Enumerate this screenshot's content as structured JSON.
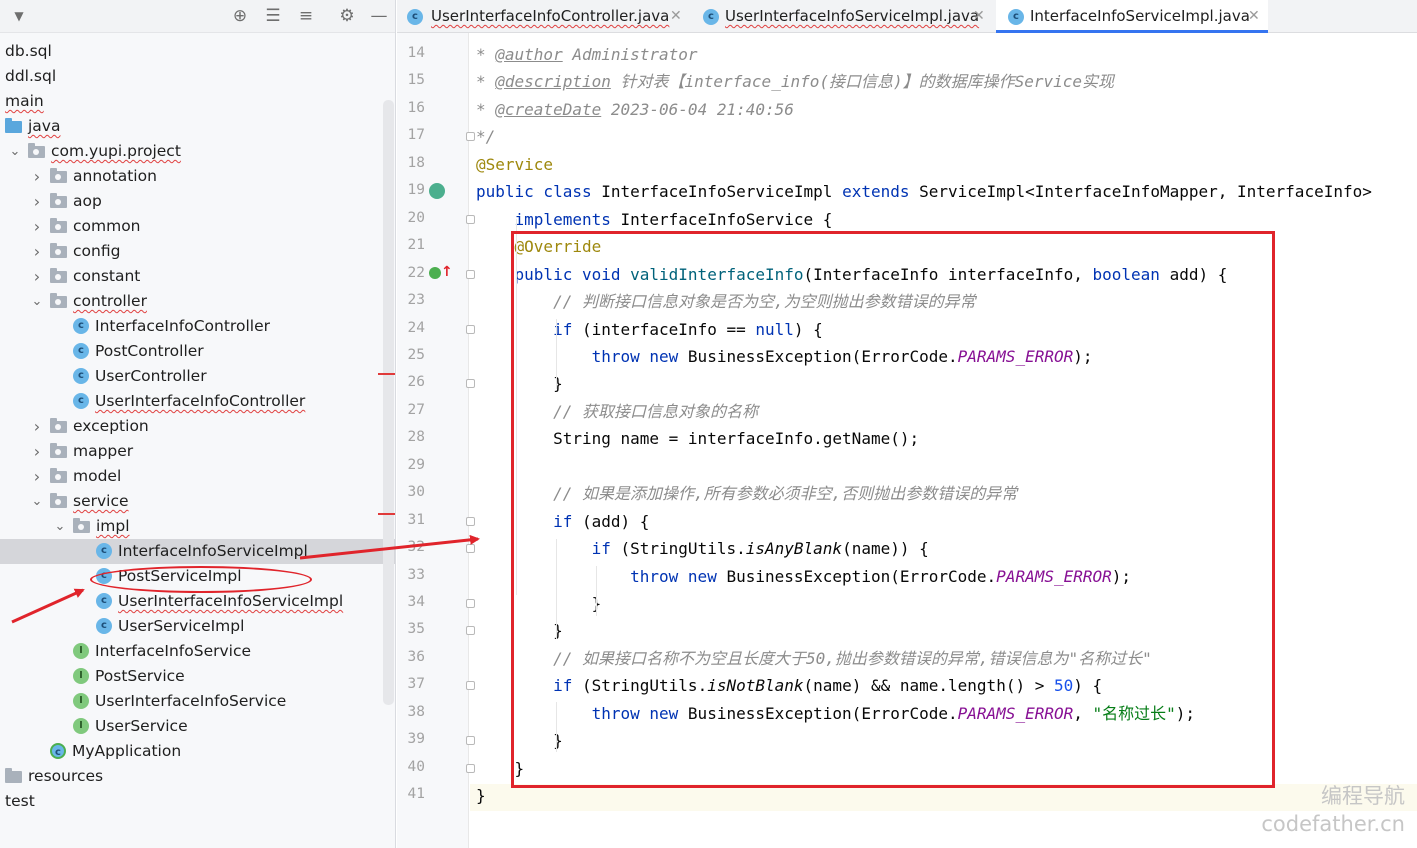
{
  "sidebar": {
    "tree": [
      {
        "label": "db.sql",
        "kind": "file",
        "level": 0
      },
      {
        "label": "ddl.sql",
        "kind": "file",
        "level": 0
      },
      {
        "label": "main",
        "kind": "text",
        "level": 0,
        "squiggle": true
      },
      {
        "label": "java",
        "kind": "folder-blue",
        "level": 0,
        "squiggle": true
      },
      {
        "label": "com.yupi.project",
        "kind": "package",
        "level": 1,
        "expanded": true,
        "squiggle": true
      },
      {
        "label": "annotation",
        "kind": "package",
        "level": 2,
        "expanded": false
      },
      {
        "label": "aop",
        "kind": "package",
        "level": 2,
        "expanded": false
      },
      {
        "label": "common",
        "kind": "package",
        "level": 2,
        "expanded": false
      },
      {
        "label": "config",
        "kind": "package",
        "level": 2,
        "expanded": false
      },
      {
        "label": "constant",
        "kind": "package",
        "level": 2,
        "expanded": false
      },
      {
        "label": "controller",
        "kind": "package",
        "level": 2,
        "expanded": true,
        "squiggle": true
      },
      {
        "label": "InterfaceInfoController",
        "kind": "class",
        "level": 3
      },
      {
        "label": "PostController",
        "kind": "class",
        "level": 3
      },
      {
        "label": "UserController",
        "kind": "class",
        "level": 3
      },
      {
        "label": "UserInterfaceInfoController",
        "kind": "class",
        "level": 3,
        "squiggle": true
      },
      {
        "label": "exception",
        "kind": "package",
        "level": 2,
        "expanded": false
      },
      {
        "label": "mapper",
        "kind": "package",
        "level": 2,
        "expanded": false
      },
      {
        "label": "model",
        "kind": "package",
        "level": 2,
        "expanded": false
      },
      {
        "label": "service",
        "kind": "package",
        "level": 2,
        "expanded": true,
        "squiggle": true
      },
      {
        "label": "impl",
        "kind": "package",
        "level": 3,
        "expanded": true,
        "squiggle": true
      },
      {
        "label": "InterfaceInfoServiceImpl",
        "kind": "class",
        "level": 4,
        "selected": true
      },
      {
        "label": "PostServiceImpl",
        "kind": "class",
        "level": 4
      },
      {
        "label": "UserInterfaceInfoServiceImpl",
        "kind": "class",
        "level": 4,
        "squiggle": true
      },
      {
        "label": "UserServiceImpl",
        "kind": "class",
        "level": 4
      },
      {
        "label": "InterfaceInfoService",
        "kind": "interface",
        "level": 3
      },
      {
        "label": "PostService",
        "kind": "interface",
        "level": 3
      },
      {
        "label": "UserInterfaceInfoService",
        "kind": "interface",
        "level": 3
      },
      {
        "label": "UserService",
        "kind": "interface",
        "level": 3
      },
      {
        "label": "MyApplication",
        "kind": "app",
        "level": 2
      },
      {
        "label": "resources",
        "kind": "folder-res",
        "level": 0
      },
      {
        "label": "test",
        "kind": "text",
        "level": 0
      }
    ]
  },
  "tabs": [
    {
      "label": "UserInterfaceInfoController.java",
      "active": false
    },
    {
      "label": "UserInterfaceInfoServiceImpl.java",
      "active": false
    },
    {
      "label": "InterfaceInfoServiceImpl.java",
      "active": true
    }
  ],
  "editor": {
    "line_numbers": [
      "14",
      "15",
      "16",
      "17",
      "18",
      "19",
      "20",
      "21",
      "22",
      "23",
      "24",
      "25",
      "26",
      "27",
      "28",
      "29",
      "30",
      "31",
      "32",
      "33",
      "34",
      "35",
      "36",
      "37",
      "38",
      "39",
      "40",
      "41"
    ],
    "lines": [
      [
        {
          "t": "* ",
          "c": "cm"
        },
        {
          "t": "@author",
          "c": "tag"
        },
        {
          "t": " Administrator",
          "c": "cm"
        }
      ],
      [
        {
          "t": "* ",
          "c": "cm"
        },
        {
          "t": "@description",
          "c": "tag"
        },
        {
          "t": " 针对表【interface_info(接口信息)】的数据库操作Service实现",
          "c": "cm"
        }
      ],
      [
        {
          "t": "* ",
          "c": "cm"
        },
        {
          "t": "@createDate",
          "c": "tag"
        },
        {
          "t": " 2023-06-04 21:40:56",
          "c": "cm"
        }
      ],
      [
        {
          "t": "*/",
          "c": "cm"
        }
      ],
      [
        {
          "t": "@Service",
          "c": "an"
        }
      ],
      [
        {
          "t": "public class ",
          "c": "kw"
        },
        {
          "t": "InterfaceInfoServiceImpl ",
          "c": ""
        },
        {
          "t": "extends ",
          "c": "kw"
        },
        {
          "t": "ServiceImpl<InterfaceInfoMapper, InterfaceInfo>",
          "c": ""
        }
      ],
      [
        {
          "t": "    "
        },
        {
          "t": "implements ",
          "c": "kw"
        },
        {
          "t": "InterfaceInfoService {",
          "c": ""
        }
      ],
      [
        {
          "t": "    "
        },
        {
          "t": "@Override",
          "c": "an"
        }
      ],
      [
        {
          "t": "    "
        },
        {
          "t": "public void ",
          "c": "kw"
        },
        {
          "t": "validInterfaceInfo",
          "c": "fn"
        },
        {
          "t": "(InterfaceInfo interfaceInfo, ",
          "c": ""
        },
        {
          "t": "boolean ",
          "c": "kw"
        },
        {
          "t": "add) {",
          "c": ""
        }
      ],
      [
        {
          "t": "        "
        },
        {
          "t": "// 判断接口信息对象是否为空,为空则抛出参数错误的异常",
          "c": "cm"
        }
      ],
      [
        {
          "t": "        "
        },
        {
          "t": "if ",
          "c": "kw"
        },
        {
          "t": "(interfaceInfo == ",
          "c": ""
        },
        {
          "t": "null",
          "c": "kw"
        },
        {
          "t": ") {",
          "c": ""
        }
      ],
      [
        {
          "t": "            "
        },
        {
          "t": "throw new ",
          "c": "kw"
        },
        {
          "t": "BusinessException(ErrorCode.",
          "c": ""
        },
        {
          "t": "PARAMS_ERROR",
          "c": "cn"
        },
        {
          "t": ");",
          "c": ""
        }
      ],
      [
        {
          "t": "        }"
        }
      ],
      [
        {
          "t": "        "
        },
        {
          "t": "// 获取接口信息对象的名称",
          "c": "cm"
        }
      ],
      [
        {
          "t": "        String name = interfaceInfo.getName();"
        }
      ],
      [
        {
          "t": ""
        }
      ],
      [
        {
          "t": "        "
        },
        {
          "t": "// 如果是添加操作,所有参数必须非空,否则抛出参数错误的异常",
          "c": "cm"
        }
      ],
      [
        {
          "t": "        "
        },
        {
          "t": "if ",
          "c": "kw"
        },
        {
          "t": "(add) {",
          "c": ""
        }
      ],
      [
        {
          "t": "            "
        },
        {
          "t": "if ",
          "c": "kw"
        },
        {
          "t": "(StringUtils.",
          "c": ""
        },
        {
          "t": "isAnyBlank",
          "c": "it"
        },
        {
          "t": "(name)) {",
          "c": ""
        }
      ],
      [
        {
          "t": "                "
        },
        {
          "t": "throw new ",
          "c": "kw"
        },
        {
          "t": "BusinessException(ErrorCode.",
          "c": ""
        },
        {
          "t": "PARAMS_ERROR",
          "c": "cn"
        },
        {
          "t": ");",
          "c": ""
        }
      ],
      [
        {
          "t": "            }"
        }
      ],
      [
        {
          "t": "        }"
        }
      ],
      [
        {
          "t": "        "
        },
        {
          "t": "// 如果接口名称不为空且长度大于50,抛出参数错误的异常,错误信息为\"名称过长\"",
          "c": "cm"
        }
      ],
      [
        {
          "t": "        "
        },
        {
          "t": "if ",
          "c": "kw"
        },
        {
          "t": "(StringUtils.",
          "c": ""
        },
        {
          "t": "isNotBlank",
          "c": "it"
        },
        {
          "t": "(name) && name.length() > ",
          "c": ""
        },
        {
          "t": "50",
          "c": "num"
        },
        {
          "t": ") {",
          "c": ""
        }
      ],
      [
        {
          "t": "            "
        },
        {
          "t": "throw new ",
          "c": "kw"
        },
        {
          "t": "BusinessException(ErrorCode.",
          "c": ""
        },
        {
          "t": "PARAMS_ERROR",
          "c": "cn"
        },
        {
          "t": ", ",
          "c": ""
        },
        {
          "t": "\"名称过长\"",
          "c": "str"
        },
        {
          "t": ");",
          "c": ""
        }
      ],
      [
        {
          "t": "        }"
        }
      ],
      [
        {
          "t": "    }"
        }
      ],
      [
        {
          "t": "}"
        }
      ]
    ]
  },
  "watermark": {
    "line1": "编程导航",
    "line2": "codefather.cn"
  },
  "colors": {
    "annotation_red": "#e0242b",
    "tab_active_underline": "#3574f0"
  }
}
